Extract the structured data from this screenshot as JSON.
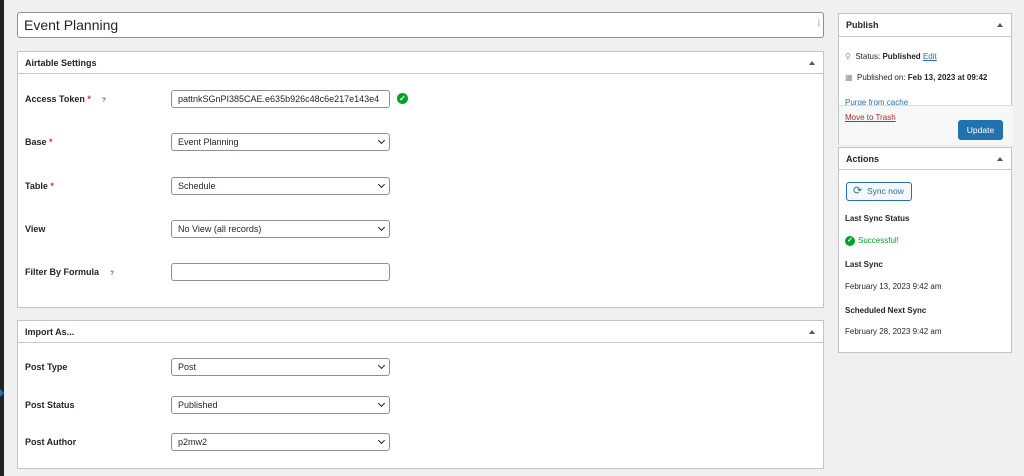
{
  "post": {
    "title": "Event Planning"
  },
  "airtable": {
    "heading": "Airtable Settings",
    "access_token": {
      "label": "Access Token",
      "value": "pattnkSGnPI385CAE.e635b926c48c6e217e143e4"
    },
    "base": {
      "label": "Base",
      "value": "Event Planning"
    },
    "table": {
      "label": "Table",
      "value": "Schedule"
    },
    "view": {
      "label": "View",
      "value": "No View (all records)"
    },
    "filter": {
      "label": "Filter By Formula",
      "value": ""
    },
    "required_mark": "*",
    "help_mark": "?"
  },
  "import_as": {
    "heading": "Import As...",
    "post_type": {
      "label": "Post Type",
      "value": "Post"
    },
    "post_status": {
      "label": "Post Status",
      "value": "Published"
    },
    "post_author": {
      "label": "Post Author",
      "value": "p2mw2"
    }
  },
  "publish": {
    "heading": "Publish",
    "status_label": "Status:",
    "status_value": "Published",
    "status_edit": "Edit",
    "published_label": "Published on:",
    "published_value": "Feb 13, 2023 at 09:42",
    "purge_link": "Purge from cache",
    "trash_link": "Move to Trash",
    "update_button": "Update"
  },
  "actions": {
    "heading": "Actions",
    "sync_button": "Sync now",
    "last_sync_status_label": "Last Sync Status",
    "last_sync_status_value": "Successful!",
    "last_sync_label": "Last Sync",
    "last_sync_value": "February 13, 2023 9:42 am",
    "next_sync_label": "Scheduled Next Sync",
    "next_sync_value": "February 28, 2023 9:42 am"
  },
  "colors": {
    "primary": "#2271b1",
    "success": "#00a32a",
    "danger": "#d63638"
  },
  "icons": [
    "pin-icon",
    "calendar-icon",
    "sync-icon",
    "checkmark-icon",
    "collapse-arrow-icon",
    "chevron-down-icon"
  ]
}
